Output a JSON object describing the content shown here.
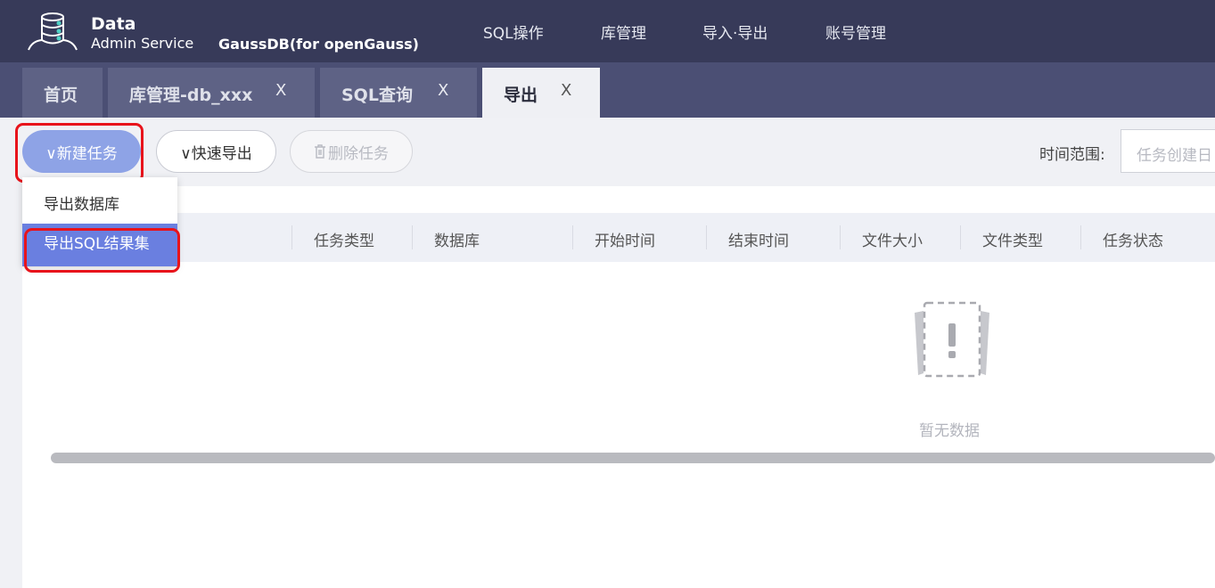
{
  "header": {
    "brand_line1": "Data",
    "brand_line2": "Admin Service",
    "product": "GaussDB(for openGauss)",
    "nav": [
      "SQL操作",
      "库管理",
      "导入·导出",
      "账号管理"
    ]
  },
  "tabs": [
    {
      "label": "首页",
      "closable": false
    },
    {
      "label": "库管理-db_xxx",
      "close": "X"
    },
    {
      "label": "SQL查询",
      "close": "X"
    },
    {
      "label": "导出",
      "close": "X",
      "active": true
    }
  ],
  "toolbar": {
    "new_task": "∨新建任务",
    "quick_export": "∨快速导出",
    "delete_task": "删除任务",
    "time_range_label": "时间范围:",
    "time_range_placeholder": "任务创建日"
  },
  "dropdown": {
    "items": [
      "导出数据库",
      "导出SQL结果集"
    ],
    "highlighted_index": 1
  },
  "table": {
    "columns": [
      "任务类型",
      "数据库",
      "开始时间",
      "结束时间",
      "文件大小",
      "文件类型",
      "任务状态"
    ],
    "empty_text": "暂无数据"
  },
  "colors": {
    "header_bg": "#373a59",
    "tabs_bg": "#4b4f74",
    "primary_button": "#8ea3e6",
    "dropdown_highlight": "#6a7fe0",
    "annotation_red": "#e8131b"
  },
  "icons": [
    "database-logo-icon",
    "trash-icon",
    "empty-data-icon"
  ]
}
